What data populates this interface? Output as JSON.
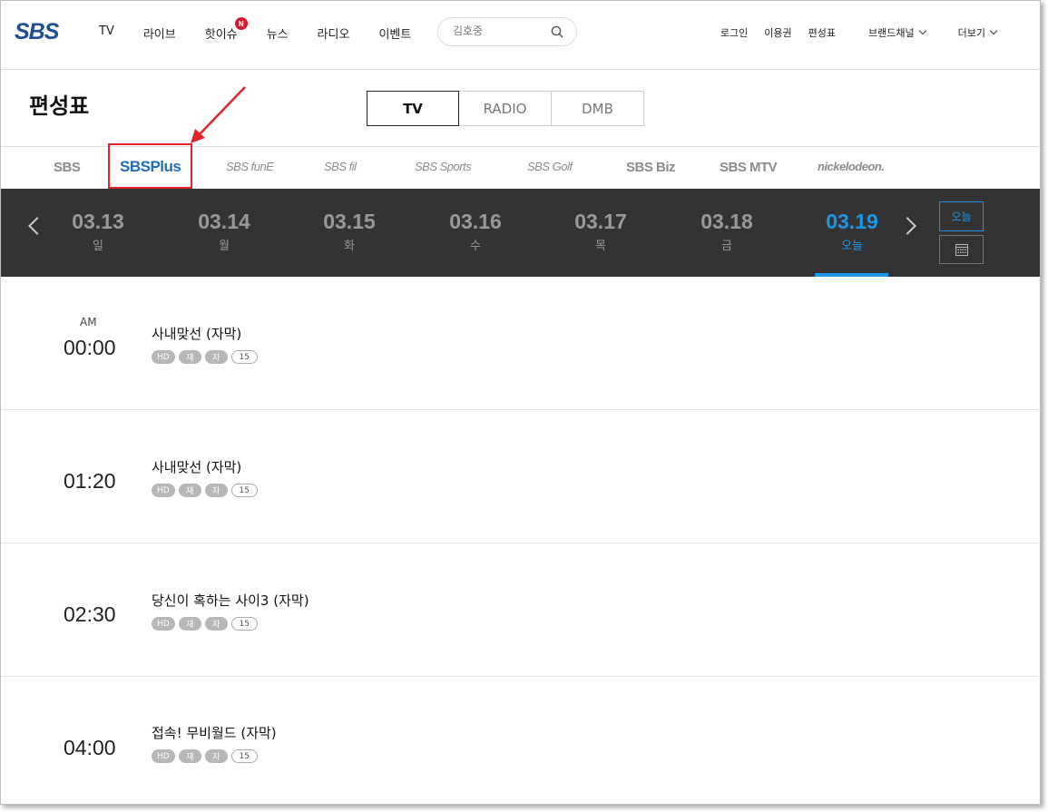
{
  "header": {
    "logo": "SBS",
    "menu": [
      "TV",
      "라이브",
      "핫이슈",
      "뉴스",
      "라디오",
      "이벤트"
    ],
    "hot_badge": "N",
    "search_placeholder": "김호중",
    "util": [
      "로그인",
      "이용권",
      "편성표",
      "브랜드채널",
      "더보기"
    ]
  },
  "page": {
    "title": "편성표",
    "tabs": [
      "TV",
      "RADIO",
      "DMB"
    ],
    "active_tab": "TV"
  },
  "channels": {
    "items": [
      "SBS",
      "SBSPlus",
      "SBS funE",
      "SBS fil",
      "SBS Sports",
      "SBS Golf",
      "SBS Biz",
      "SBS MTV",
      "nickelodeon."
    ],
    "selected": "SBSPlus"
  },
  "dates": {
    "items": [
      {
        "date": "03.13",
        "day": "일"
      },
      {
        "date": "03.14",
        "day": "월"
      },
      {
        "date": "03.15",
        "day": "화"
      },
      {
        "date": "03.16",
        "day": "수"
      },
      {
        "date": "03.17",
        "day": "목"
      },
      {
        "date": "03.18",
        "day": "금"
      },
      {
        "date": "03.19",
        "day": "오늘"
      }
    ],
    "today_button": "오늘"
  },
  "programs": [
    {
      "ampm": "AM",
      "time": "00:00",
      "title": "사내맞선 (자막)",
      "badges": [
        "HD",
        "재",
        "자"
      ],
      "age": "15"
    },
    {
      "ampm": "",
      "time": "01:20",
      "title": "사내맞선 (자막)",
      "badges": [
        "HD",
        "재",
        "자"
      ],
      "age": "15"
    },
    {
      "ampm": "",
      "time": "02:30",
      "title": "당신이 혹하는 사이3 (자막)",
      "badges": [
        "HD",
        "재",
        "자"
      ],
      "age": "15"
    },
    {
      "ampm": "",
      "time": "04:00",
      "title": "접속! 무비월드 (자막)",
      "badges": [
        "HD",
        "재",
        "자"
      ],
      "age": "15"
    }
  ],
  "colors": {
    "brand": "#1d4f91",
    "accent": "#1e96e8",
    "highlight": "#e0242a",
    "datebar": "#333333"
  }
}
